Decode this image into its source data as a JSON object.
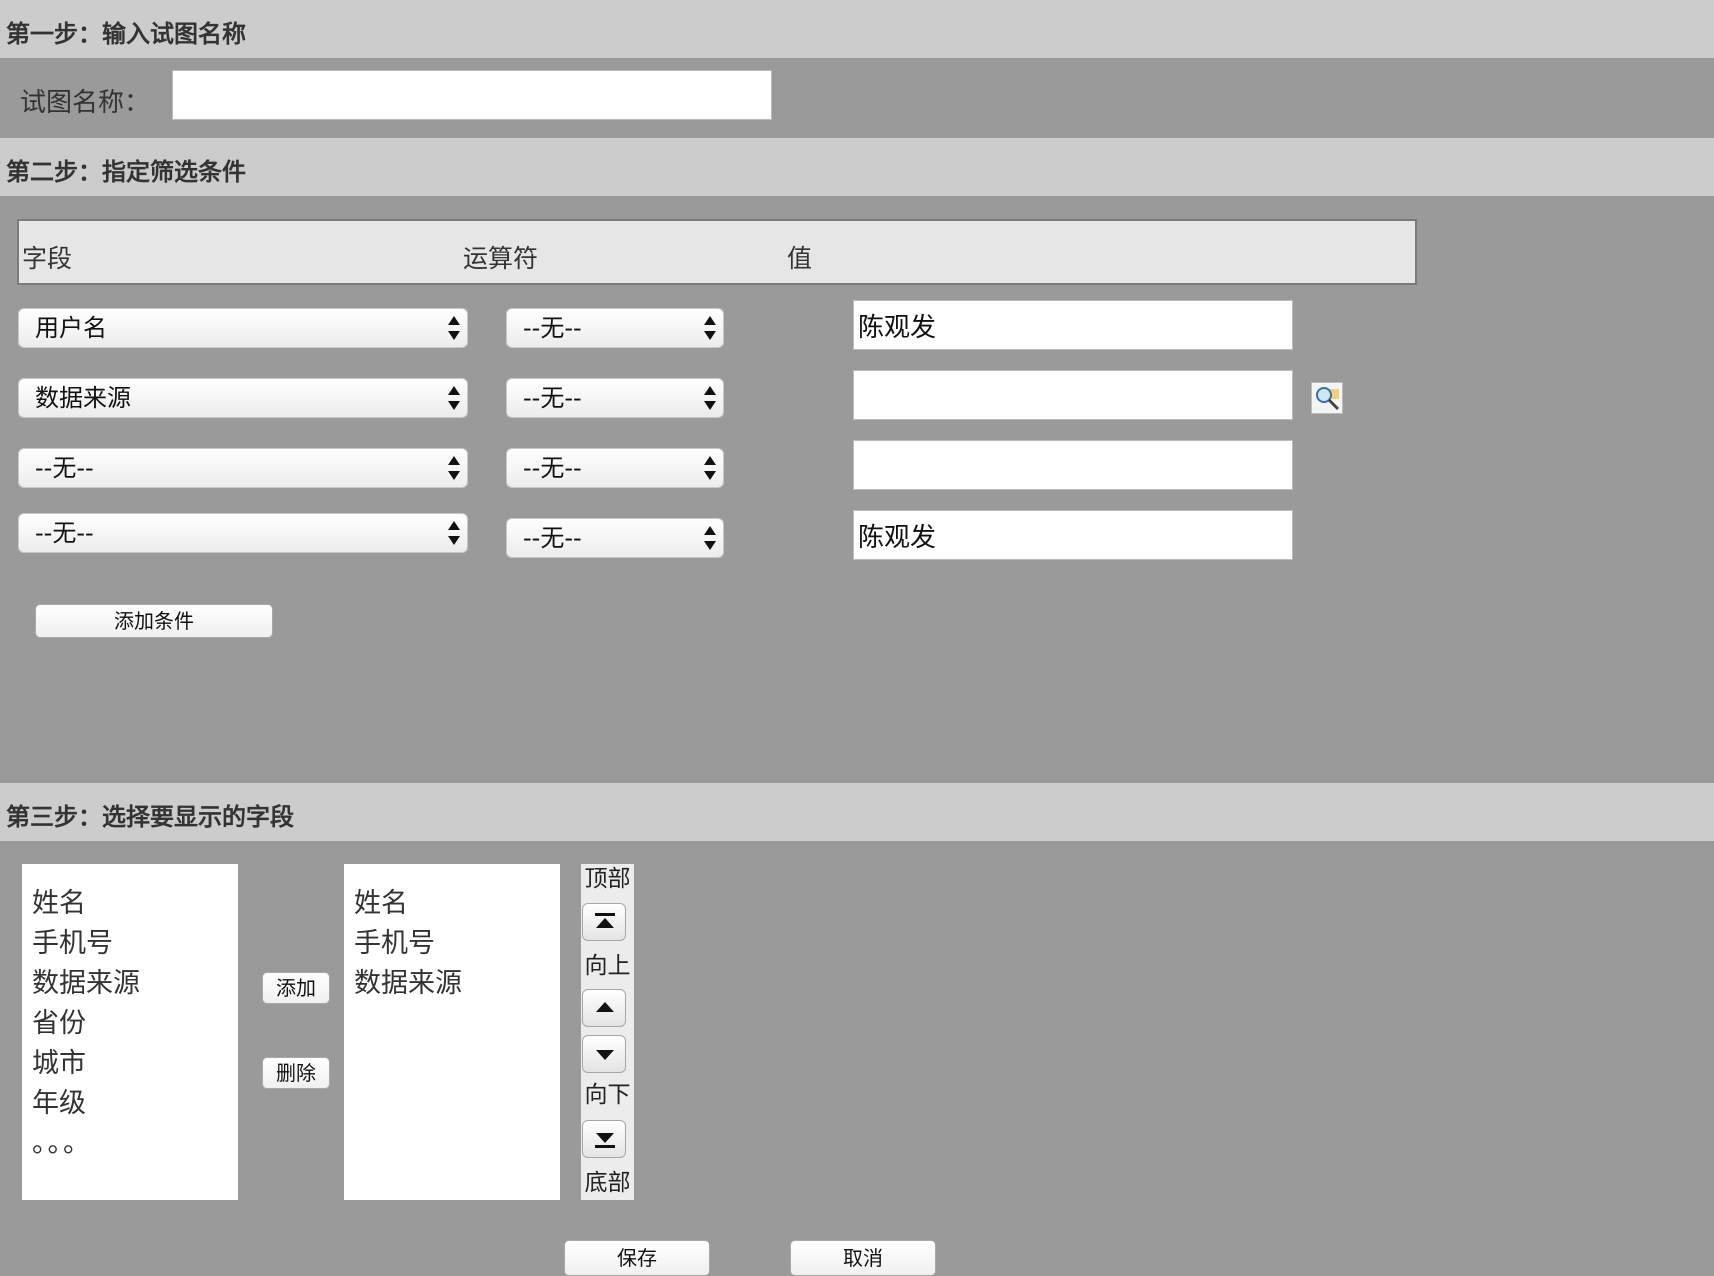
{
  "step1": {
    "header": "第一步：输入试图名称",
    "label": "试图名称：",
    "value": ""
  },
  "step2": {
    "header": "第二步：指定筛选条件",
    "columns": {
      "field": "字段",
      "operator": "运算符",
      "value": "值"
    },
    "rows": [
      {
        "field": "用户名",
        "operator": "--无--",
        "value": "陈观发"
      },
      {
        "field": "数据来源",
        "operator": "--无--",
        "value": ""
      },
      {
        "field": "--无--",
        "operator": "--无--",
        "value": ""
      },
      {
        "field": "--无--",
        "operator": "--无--",
        "value": "陈观发"
      }
    ],
    "add_condition": "添加条件"
  },
  "step3": {
    "header": "第三步：选择要显示的字段",
    "available_fields": [
      "姓名",
      "手机号",
      "数据来源",
      "省份",
      "城市",
      "年级",
      "。。。"
    ],
    "selected_fields": [
      "姓名",
      "手机号",
      "数据来源"
    ],
    "add": "添加",
    "remove": "删除",
    "order": {
      "top": "顶部",
      "up": "向上",
      "down": "向下",
      "bottom": "底部"
    }
  },
  "footer": {
    "save": "保存",
    "cancel": "取消"
  },
  "colors": {
    "background": "#9a9a9a",
    "header": "#cccccc"
  }
}
